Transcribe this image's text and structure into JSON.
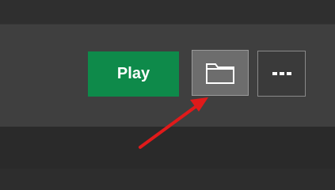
{
  "toolbar": {
    "play_label": "Play",
    "folder_icon": "folder-icon",
    "more_icon": "ellipsis-icon"
  },
  "colors": {
    "play_green": "#0e8a4a",
    "annotation_red": "#e01a1a",
    "panel_gray": "#3f3f3f"
  }
}
